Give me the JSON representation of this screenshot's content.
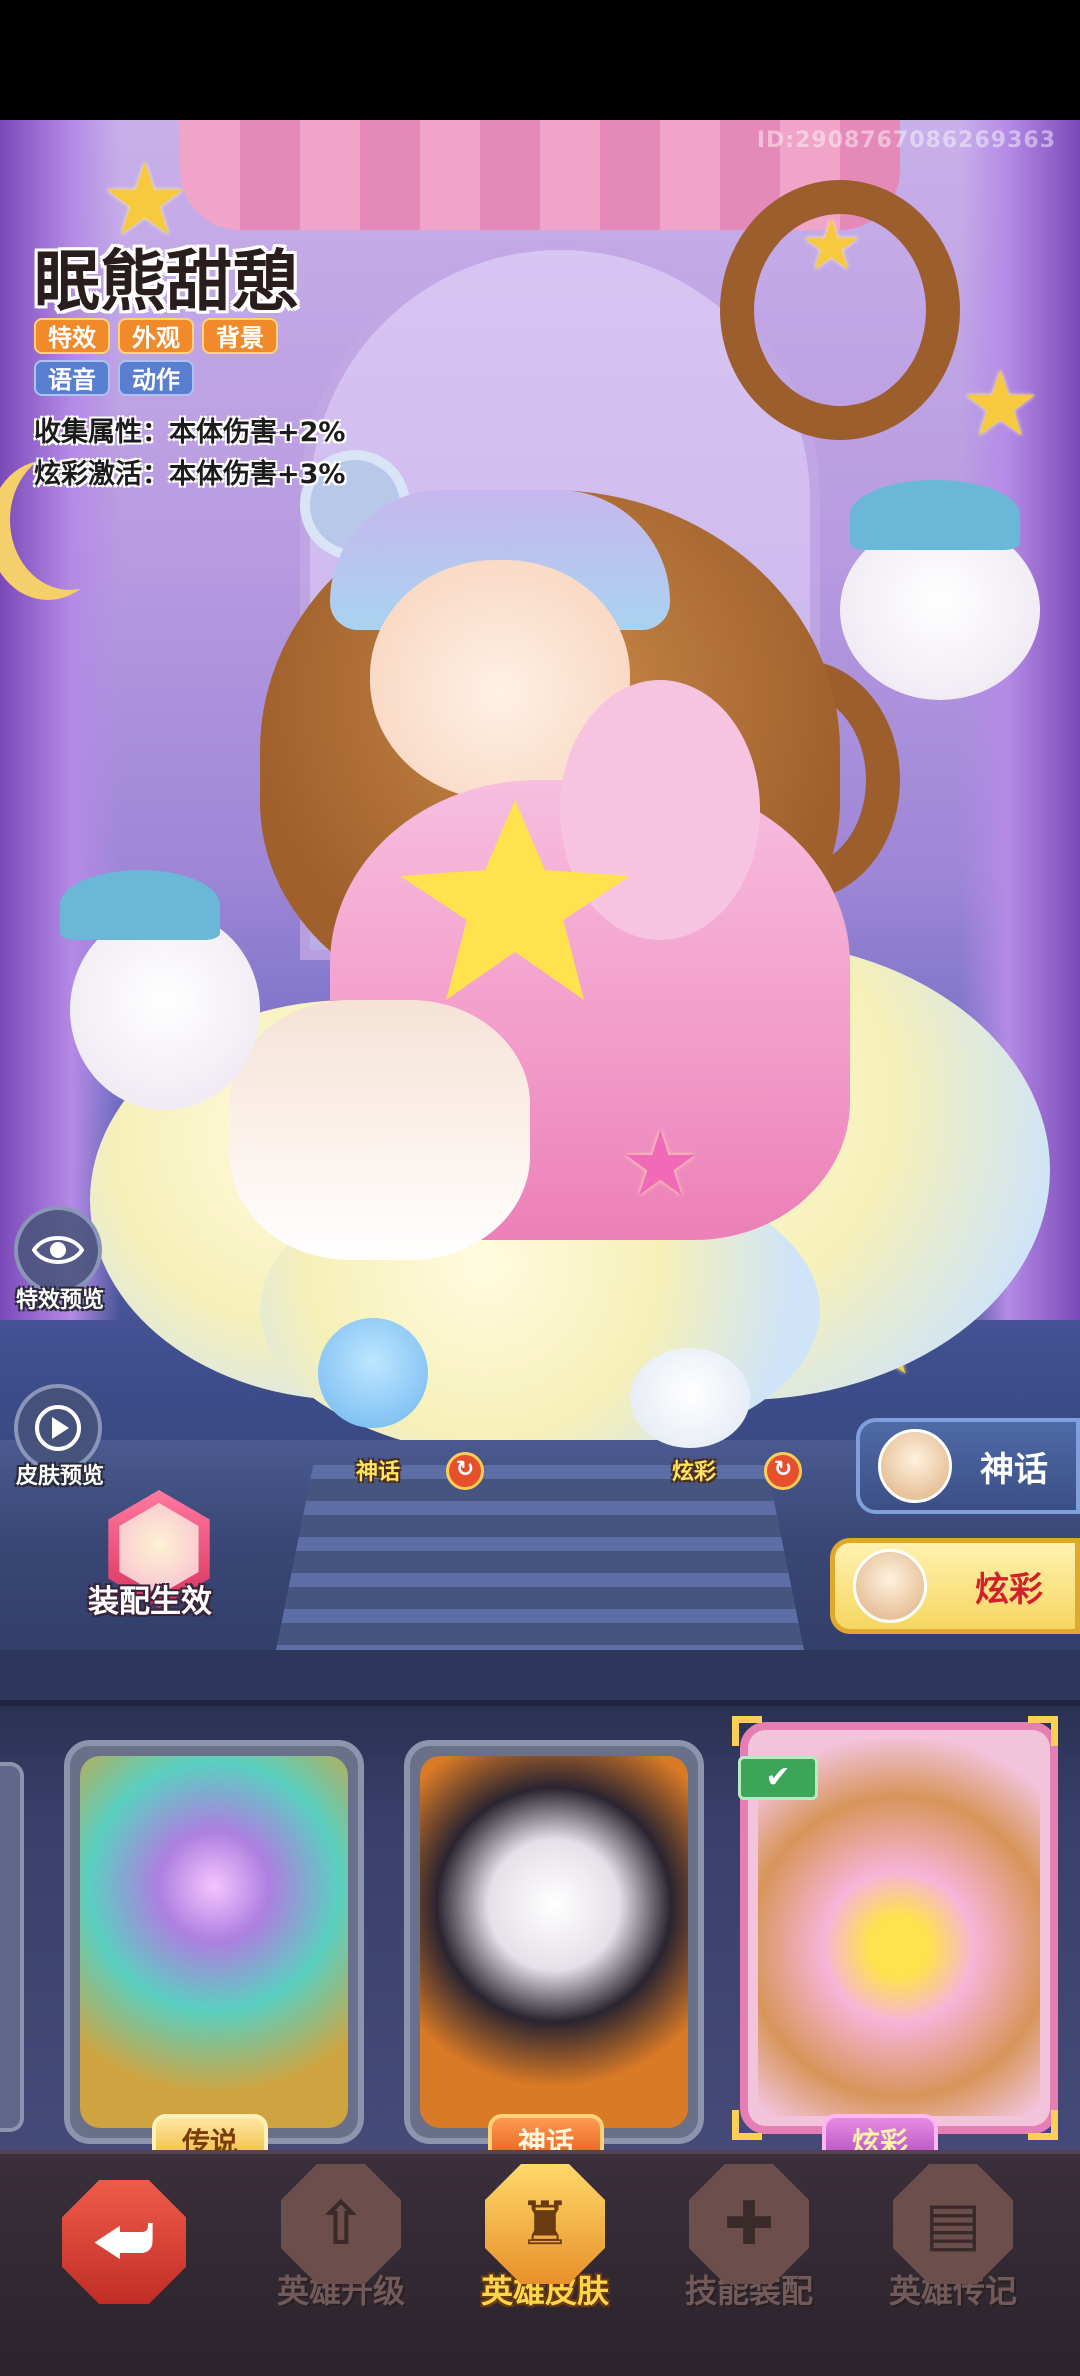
{
  "skin": {
    "name": "眠熊甜憩",
    "tags_row1": [
      "特效",
      "外观",
      "背景"
    ],
    "tags_row2": [
      "语音",
      "动作"
    ],
    "collect_attr": "收集属性：本体伤害+2%",
    "color_attr": "炫彩激活：本体伤害+3%"
  },
  "player_id": "ID:2908767086269363",
  "side_buttons": {
    "effect_preview": "特效预览",
    "skin_preview": "皮肤预览"
  },
  "equip": {
    "label": "装配生效"
  },
  "pets": {
    "left_label": "神话",
    "right_label": "炫彩"
  },
  "variant_tabs": {
    "myth": "神话",
    "color": "炫彩"
  },
  "cards": [
    {
      "rarity": "传说"
    },
    {
      "rarity": "神话"
    },
    {
      "rarity": "炫彩",
      "equipped_check": "✔"
    }
  ],
  "nav": {
    "back_icon": "⮨",
    "items": [
      {
        "label": "英雄升级",
        "icon": "⇧"
      },
      {
        "label": "英雄皮肤",
        "icon": "♜"
      },
      {
        "label": "技能装配",
        "icon": "✚"
      },
      {
        "label": "英雄传记",
        "icon": "▤"
      }
    ],
    "active_index": 1
  },
  "colors": {
    "accent_gold": "#ffd54a",
    "rarity_legend": "#f0b83c",
    "rarity_myth": "#e25d1a",
    "rarity_color": "#b14cc2",
    "equip_pink": "#d8325e"
  }
}
